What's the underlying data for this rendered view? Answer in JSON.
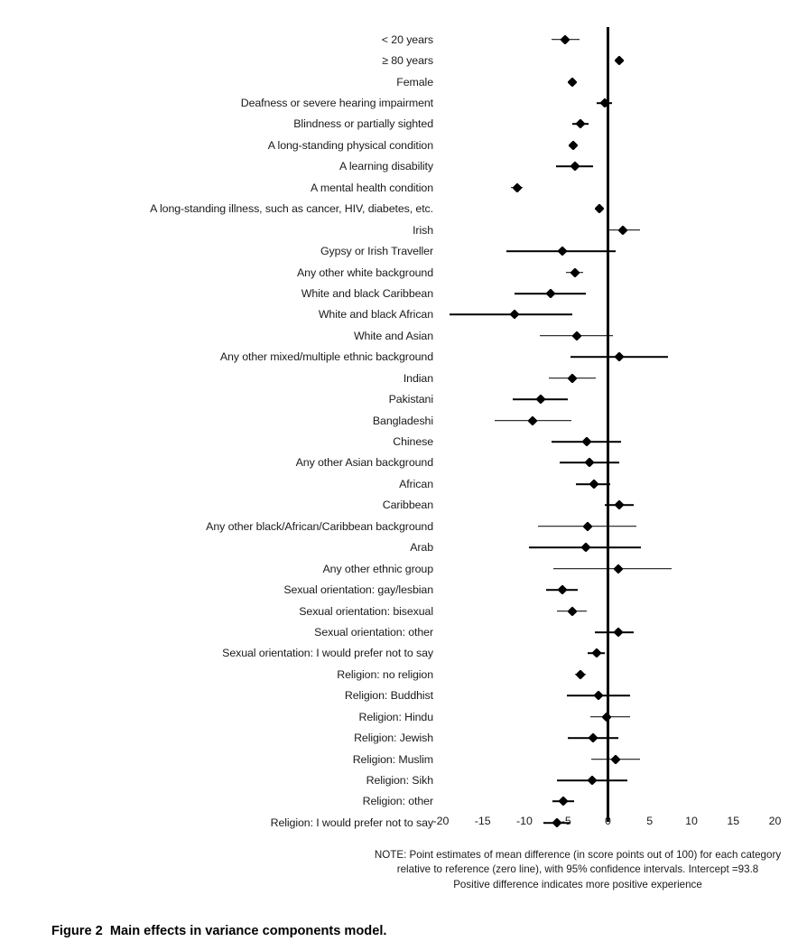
{
  "figure": {
    "caption_number": "Figure 2",
    "caption_text": "Main effects in variance components model."
  },
  "note": {
    "line1": "NOTE: Point estimates of mean difference (in score points out of 100) for each category",
    "line2": "relative to reference (zero line), with 95% confidence intervals. Intercept =93.8",
    "line3": "Positive difference indicates more positive experience"
  },
  "chart_data": {
    "type": "scatter",
    "title": "Main effects in variance components model.",
    "xlabel": "",
    "ylabel": "",
    "xlim": [
      -20,
      20
    ],
    "xticks": [
      -20,
      -15,
      -10,
      -5,
      0,
      5,
      10,
      15,
      20
    ],
    "xtick_labels": [
      "-20",
      "-15",
      "-10",
      "-5",
      "0",
      "5",
      "10",
      "15",
      "20"
    ],
    "grid": false,
    "legend": "none",
    "reference_line": 0,
    "intercept": 93.8,
    "annotation": "Point estimates of mean difference (in score points out of 100) for each category relative to reference (zero line), with 95% confidence intervals.",
    "categories": [
      "< 20 years",
      "≥ 80 years",
      "Female",
      "Deafness or severe hearing impairment",
      "Blindness or partially sighted",
      "A long-standing physical condition",
      "A learning disability",
      "A mental health condition",
      "A long-standing illness, such as cancer, HIV, diabetes, etc.",
      "Irish",
      "Gypsy or Irish Traveller",
      "Any other white background",
      "White and black Caribbean",
      "White and black African",
      "White and Asian",
      "Any other mixed/multiple ethnic background",
      "Indian",
      "Pakistani",
      "Bangladeshi",
      "Chinese",
      "Any other Asian background",
      "African",
      "Caribbean",
      "Any other black/African/Caribbean background",
      "Arab",
      "Any other ethnic group",
      "Sexual orientation: gay/lesbian",
      "Sexual orientation: bisexual",
      "Sexual orientation: other",
      "Sexual orientation: I would prefer not to say",
      "Religion: no religion",
      "Religion: Buddhist",
      "Religion: Hindu",
      "Religion: Jewish",
      "Religion: Muslim",
      "Religion: Sikh",
      "Religion: other",
      "Religion: I would prefer not to say"
    ],
    "estimates": [
      -5.1,
      1.4,
      -4.3,
      -0.4,
      -3.3,
      -4.2,
      -4.0,
      -10.9,
      -1.0,
      1.8,
      -5.5,
      -4.0,
      -6.9,
      -11.2,
      -3.7,
      1.4,
      -4.3,
      -8.1,
      -9.0,
      -2.5,
      -2.2,
      -1.7,
      1.4,
      -2.4,
      -2.7,
      1.2,
      -5.5,
      -4.3,
      1.2,
      -1.4,
      -3.3,
      -1.1,
      -0.2,
      -1.8,
      0.9,
      -1.9,
      -5.3,
      -6.1
    ],
    "ci_low": [
      -6.8,
      0.9,
      -4.8,
      -1.3,
      -4.3,
      -4.7,
      -6.2,
      -11.6,
      -1.3,
      0.0,
      -12.2,
      -5.0,
      -11.2,
      -19.0,
      -8.2,
      -4.5,
      -7.1,
      -11.4,
      -13.6,
      -6.8,
      -5.8,
      -3.8,
      -0.4,
      -8.4,
      -9.5,
      -6.5,
      -7.4,
      -6.1,
      -1.6,
      -2.4,
      -3.9,
      -4.9,
      -2.1,
      -4.8,
      -2.0,
      -6.1,
      -6.6,
      -7.7
    ],
    "ci_high": [
      -3.4,
      1.9,
      -3.8,
      0.5,
      -2.3,
      -3.7,
      -1.8,
      -10.2,
      -0.7,
      3.8,
      0.9,
      -3.0,
      -2.6,
      -4.3,
      0.6,
      7.2,
      -1.5,
      -4.8,
      -4.4,
      1.6,
      1.3,
      0.3,
      3.1,
      3.4,
      3.9,
      7.6,
      -3.6,
      -2.5,
      3.1,
      -0.4,
      -2.7,
      2.7,
      2.7,
      1.2,
      3.8,
      2.3,
      -4.0,
      -4.5
    ]
  }
}
